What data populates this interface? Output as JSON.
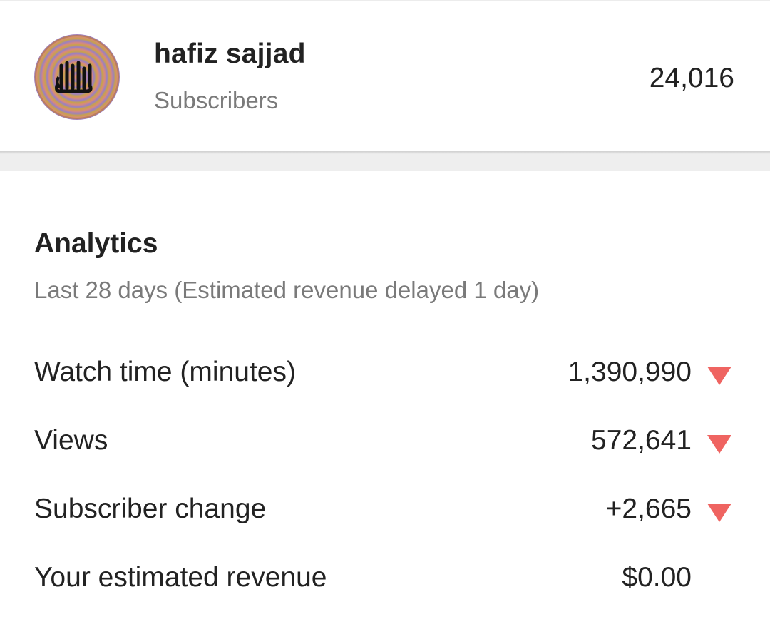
{
  "channel": {
    "name": "hafiz sajjad",
    "subscribers_label": "Subscribers",
    "subscriber_count": "24,016",
    "avatar_icon": "calligraphy-avatar"
  },
  "analytics": {
    "title": "Analytics",
    "subtitle": "Last 28 days (Estimated revenue delayed 1 day)",
    "metrics": [
      {
        "label": "Watch time (minutes)",
        "value": "1,390,990",
        "trend": "down"
      },
      {
        "label": "Views",
        "value": "572,641",
        "trend": "down"
      },
      {
        "label": "Subscriber change",
        "value": "+2,665",
        "trend": "down"
      },
      {
        "label": "Your estimated revenue",
        "value": "$0.00",
        "trend": "none"
      }
    ]
  },
  "colors": {
    "trend_down": "#ef6461",
    "primary_text": "#222222",
    "secondary_text": "#7a7a7a"
  }
}
